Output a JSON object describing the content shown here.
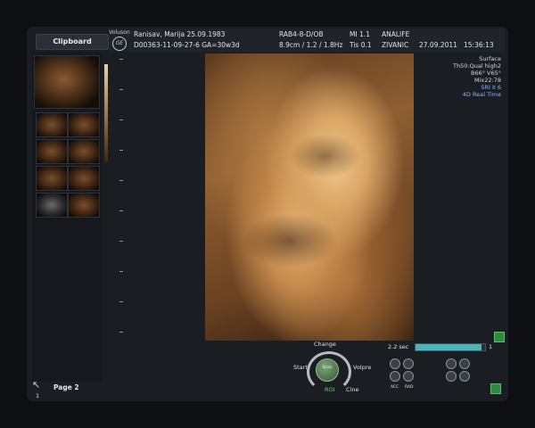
{
  "clipboard": {
    "title": "Clipboard"
  },
  "header": {
    "logo_text": "Voluson",
    "logo_mark": "GE",
    "patient_line1": "Ranisav, Marija 25.09.1983",
    "patient_line2": "D00363-11-09-27-6  GA=30w3d",
    "probe": "RAB4-8-D/OB",
    "params": "8.9cm / 1.2 / 1.8Hz",
    "mi": "MI  1.1",
    "tis": "Tis  0.1",
    "institution_line1": "ANALIFE",
    "institution_line2": "ZIVANIC",
    "date": "27.09.2011",
    "time": "15:36:13"
  },
  "render_info": {
    "lines": [
      "Surface",
      "Th50:Qual high2",
      "B66° V65°",
      "Mix22:78"
    ],
    "blue_lines": [
      "SRI II 6",
      "4D Real Time"
    ]
  },
  "controls": {
    "change": "Change",
    "start": "Start",
    "volpre": "Volpre",
    "roi": "ROI",
    "cine": "Cine",
    "knob_label": "Scan",
    "timer": "2.2 sec",
    "progress_value": 1,
    "progress_fraction": 0.95,
    "bottom_small_left": "ACC",
    "bottom_small_right": "RAD"
  },
  "footer": {
    "page": "Page 2",
    "page_number": "1"
  },
  "colors": {
    "accent": "#4fb2b8",
    "sepia": "#d9a564"
  }
}
